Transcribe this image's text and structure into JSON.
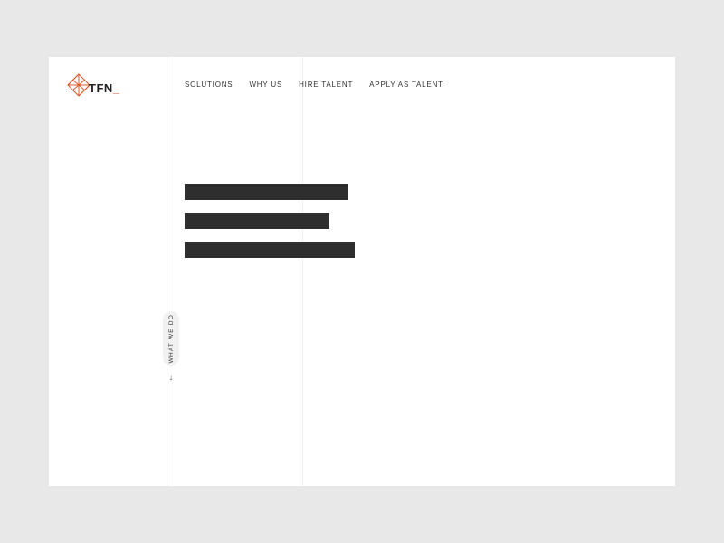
{
  "logo": {
    "text": "TFN",
    "accent": "_"
  },
  "nav": {
    "items": [
      {
        "label": "SOLUTIONS"
      },
      {
        "label": "WHY US"
      },
      {
        "label": "HIRE TALENT"
      },
      {
        "label": "APPLY AS TALENT"
      }
    ]
  },
  "scroll_cue": {
    "label": "WHAT WE DO",
    "arrow": "↓"
  }
}
